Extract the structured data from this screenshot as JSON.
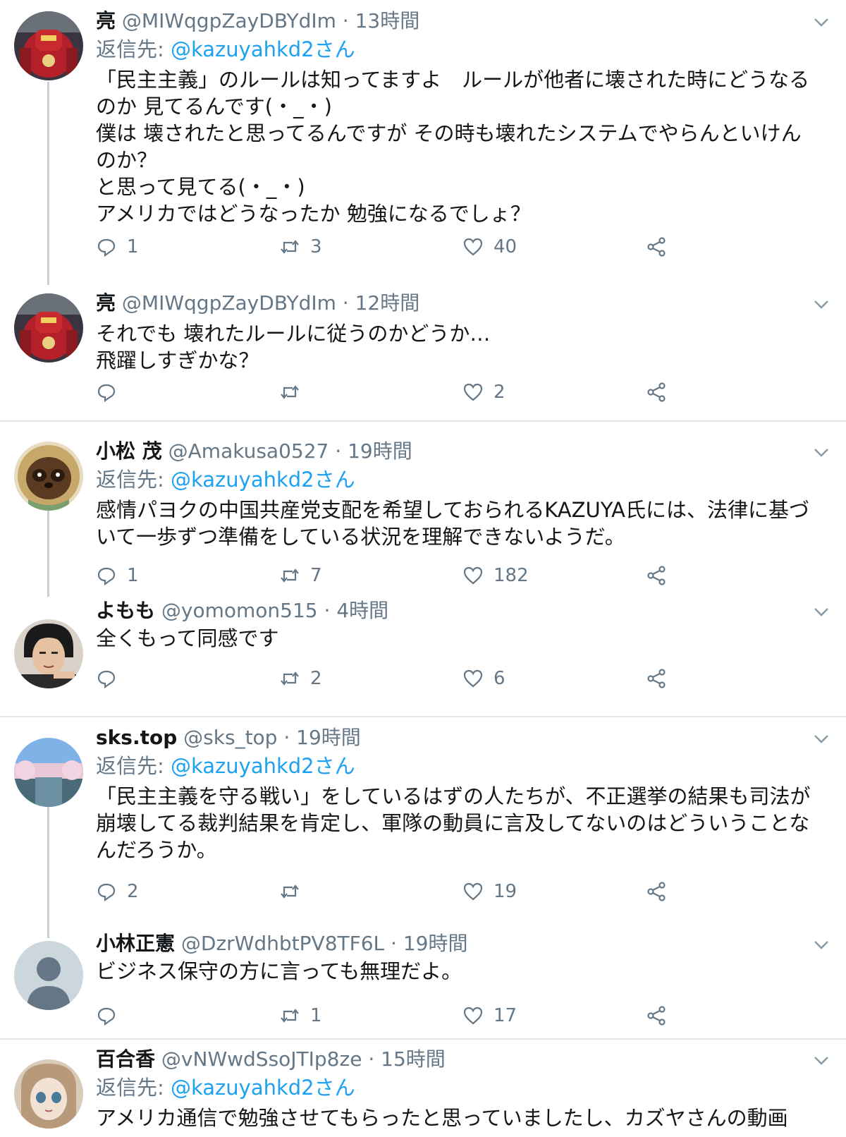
{
  "tweets": [
    {
      "name": "亮",
      "handle": "@MIWqgpZayDBYdIm",
      "time": "13時間",
      "reply_prefix": "返信先: ",
      "reply_to": "@kazuyahkd2さん",
      "text": "「民主主義」のルールは知ってますよ　ルールが他者に壊された時にどうなるのか 見てるんです(・_・)\n僕は 壊されたと思ってるんですが その時も壊れたシステムでやらんといけんのか？\nと思って見てる(・_・)\nアメリカではどうなったか 勉強になるでしょ？",
      "replies": "1",
      "retweets": "3",
      "likes": "40"
    },
    {
      "name": "亮",
      "handle": "@MIWqgpZayDBYdIm",
      "time": "12時間",
      "text": "それでも 壊れたルールに従うのかどうか…\n飛躍しすぎかな？",
      "replies": "",
      "retweets": "",
      "likes": "2"
    },
    {
      "name": "小松 茂",
      "handle": "@Amakusa0527",
      "time": "19時間",
      "reply_prefix": "返信先: ",
      "reply_to": "@kazuyahkd2さん",
      "text": "感情パヨクの中国共産党支配を希望しておられるKAZUYA氏には、法律に基づいて一歩ずつ準備をしている状況を理解できないようだ。",
      "replies": "1",
      "retweets": "7",
      "likes": "182"
    },
    {
      "name": "よもも",
      "handle": "@yomomon515",
      "time": "4時間",
      "text": "全くもって同感です",
      "replies": "",
      "retweets": "2",
      "likes": "6"
    },
    {
      "name": "sks.top",
      "handle": "@sks_top",
      "time": "19時間",
      "reply_prefix": "返信先: ",
      "reply_to": "@kazuyahkd2さん",
      "text": "「民主主義を守る戦い」をしているはずの人たちが、不正選挙の結果も司法が崩壊してる裁判結果を肯定し、軍隊の動員に言及してないのはどういうことなんだろうか。",
      "replies": "2",
      "retweets": "",
      "likes": "19"
    },
    {
      "name": "小林正憲",
      "handle": "@DzrWdhbtPV8TF6L",
      "time": "19時間",
      "text": "ビジネス保守の方に言っても無理だよ。",
      "replies": "",
      "retweets": "1",
      "likes": "17"
    },
    {
      "name": "百合香",
      "handle": "@vNWwdSsoJTIp8ze",
      "time": "15時間",
      "reply_prefix": "返信先: ",
      "reply_to": "@kazuyahkd2さん",
      "text": "アメリカ通信で勉強させてもらったと思っていましたし、カズヤさんの動画"
    }
  ],
  "separator": " · ",
  "colors": {
    "name": "#14171a",
    "secondary": "#657786",
    "link": "#1da1f2",
    "divider": "#e1e8ed"
  }
}
